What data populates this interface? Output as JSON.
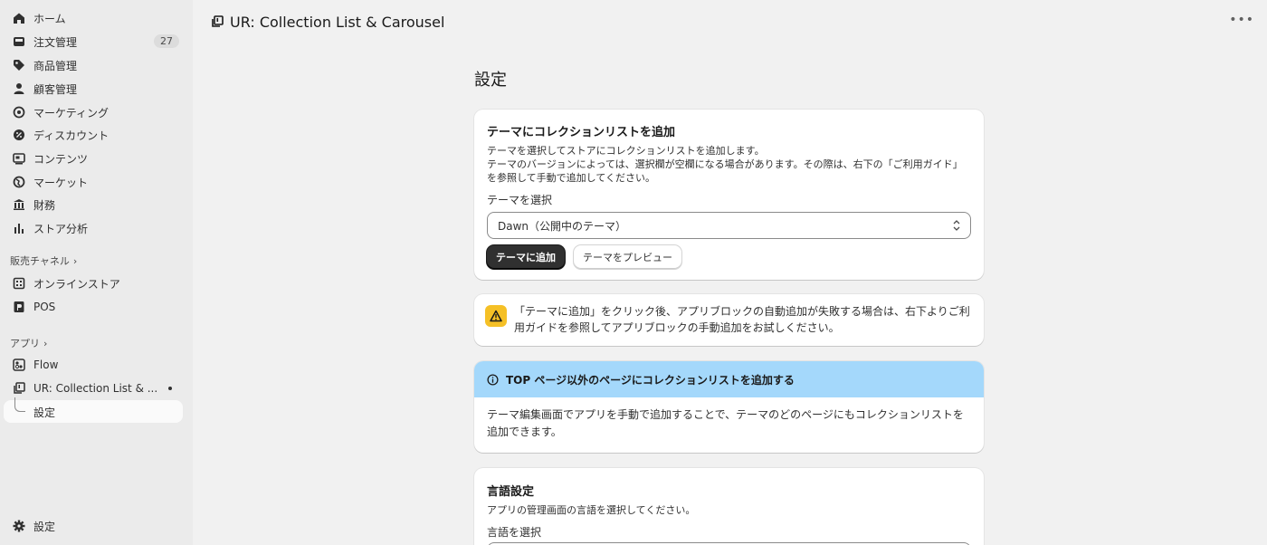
{
  "sidebar": {
    "items": [
      {
        "label": "ホーム",
        "icon": "home-icon"
      },
      {
        "label": "注文管理",
        "icon": "inbox-icon",
        "badge": "27"
      },
      {
        "label": "商品管理",
        "icon": "tag-icon"
      },
      {
        "label": "顧客管理",
        "icon": "person-icon"
      },
      {
        "label": "マーケティング",
        "icon": "target-icon"
      },
      {
        "label": "ディスカウント",
        "icon": "discount-icon"
      },
      {
        "label": "コンテンツ",
        "icon": "content-icon"
      },
      {
        "label": "マーケット",
        "icon": "globe-icon"
      },
      {
        "label": "財務",
        "icon": "bank-icon"
      },
      {
        "label": "ストア分析",
        "icon": "bar-chart-icon"
      }
    ],
    "sales_channels_label": "販売チャネル",
    "channels": [
      {
        "label": "オンラインストア",
        "icon": "store-icon"
      },
      {
        "label": "POS",
        "icon": "pos-icon"
      }
    ],
    "apps_label": "アプリ",
    "apps": [
      {
        "label": "Flow",
        "icon": "flow-icon"
      },
      {
        "label": "UR: Collection List & ...",
        "icon": "app-icon"
      }
    ],
    "app_sub_item": "設定",
    "settings_label": "設定"
  },
  "header": {
    "title": "UR: Collection List & Carousel",
    "more": "•••"
  },
  "main": {
    "page_title": "設定",
    "theme_card": {
      "title": "テーマにコレクションリストを追加",
      "desc1": "テーマを選択してストアにコレクションリストを追加します。",
      "desc2": "テーマのバージョンによっては、選択欄が空欄になる場合があります。その際は、右下の「ご利用ガイド」",
      "desc3": "を参照して手動で追加してください。",
      "select_label": "テーマを選択",
      "select_value": "Dawn（公開中のテーマ）",
      "add_button": "テーマに追加",
      "preview_button": "テーマをプレビュー"
    },
    "warning_card": {
      "line1": "「テーマに追加」をクリック後、アプリブロックの自動追加が失敗する場合は、右下よりご利",
      "line2": "用ガイドを参照してアプリブロックの手動追加をお試しください。"
    },
    "info_card": {
      "title": "TOP ページ以外のページにコレクションリストを追加する",
      "line1": "テーマ編集画面でアプリを手動で追加することで、テーマのどのページにもコレクションリストを",
      "line2": "追加できます。"
    },
    "language_card": {
      "title": "言語設定",
      "desc": "アプリの管理画面の言語を選択してください。",
      "select_label": "言語を選択"
    }
  },
  "colors": {
    "info_banner": "#a4d8fb",
    "warning": "#f5c026",
    "primary_button": "#303030"
  }
}
